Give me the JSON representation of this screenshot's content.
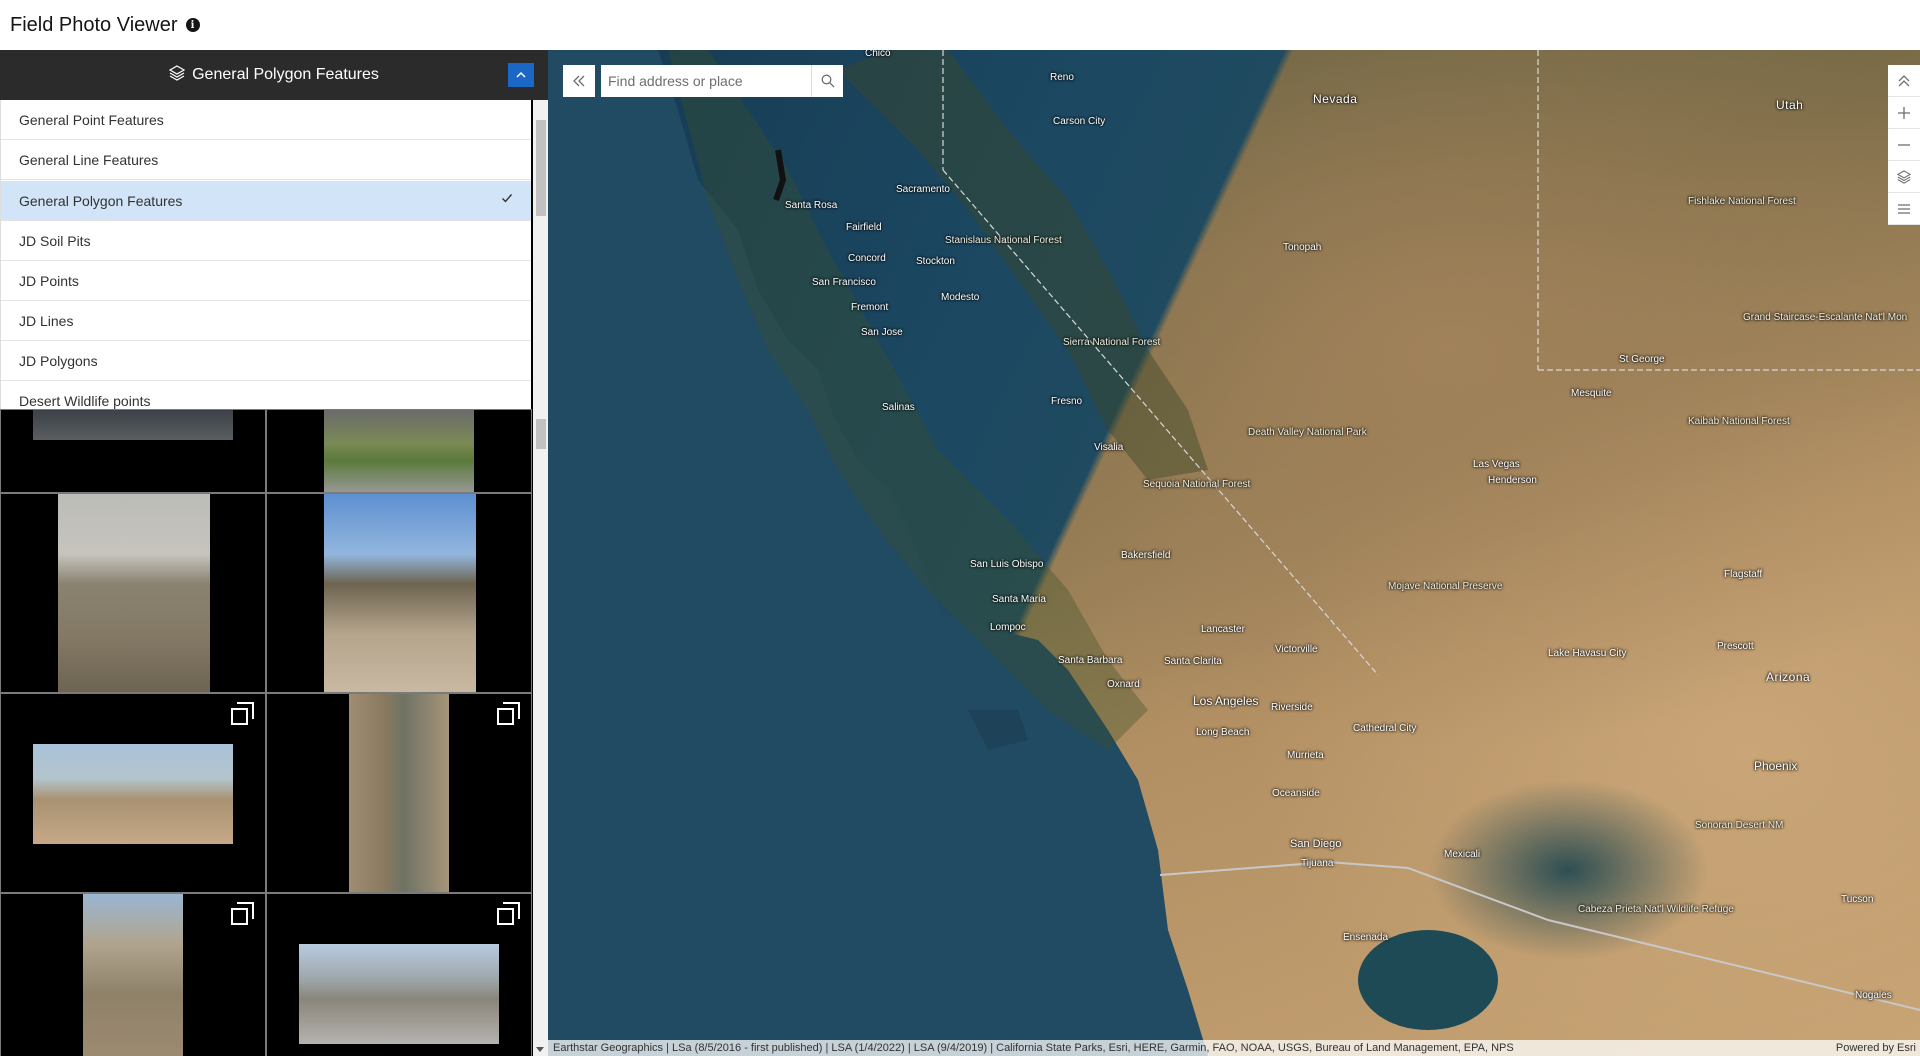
{
  "app": {
    "title": "Field Photo Viewer",
    "info_icon": "info-icon"
  },
  "layer_panel": {
    "selected_layer": "General Polygon Features",
    "items": [
      {
        "label": "General Point Features",
        "selected": false
      },
      {
        "label": "General Line Features",
        "selected": false
      },
      {
        "label": "General Polygon Features",
        "selected": true
      },
      {
        "label": "JD Soil Pits",
        "selected": false
      },
      {
        "label": "JD Points",
        "selected": false
      },
      {
        "label": "JD Lines",
        "selected": false
      },
      {
        "label": "JD Polygons",
        "selected": false
      },
      {
        "label": "Desert Wildlife points",
        "selected": false
      }
    ]
  },
  "photo_grid": {
    "tiles": [
      {
        "name": "photo-tile-1",
        "multi": false
      },
      {
        "name": "photo-tile-2",
        "multi": false
      },
      {
        "name": "photo-tile-3",
        "multi": false
      },
      {
        "name": "photo-tile-4",
        "multi": false
      },
      {
        "name": "photo-tile-5",
        "multi": true
      },
      {
        "name": "photo-tile-6",
        "multi": true
      },
      {
        "name": "photo-tile-7",
        "multi": true
      },
      {
        "name": "photo-tile-8",
        "multi": true
      }
    ]
  },
  "search": {
    "placeholder": "Find address or place"
  },
  "map_labels": {
    "states": [
      "Nevada",
      "Utah",
      "Arizona"
    ],
    "cities": [
      "Chico",
      "Reno",
      "Carson City",
      "Sacramento",
      "Santa Rosa",
      "Fairfield",
      "Concord",
      "Stockton",
      "San Francisco",
      "Fremont",
      "Modesto",
      "San Jose",
      "Salinas",
      "Fresno",
      "Visalia",
      "Bakersfield",
      "San Luis Obispo",
      "Santa Maria",
      "Lompoc",
      "Santa Barbara",
      "Oxnard",
      "Santa Clarita",
      "Los Angeles",
      "Long Beach",
      "Lancaster",
      "Victorville",
      "Riverside",
      "Cathedral City",
      "Murrieta",
      "Oceanside",
      "San Diego",
      "Tijuana",
      "Ensenada",
      "Mexicali",
      "Las Vegas",
      "Henderson",
      "Tonopah",
      "Mesquite",
      "St George",
      "Lake Havasu City",
      "Flagstaff",
      "Prescott",
      "Phoenix",
      "Tucson",
      "Nogales"
    ],
    "areas": [
      "Stanislaus National Forest",
      "Sierra National Forest",
      "Sequoia National Forest",
      "Death Valley National Park",
      "Mojave National Preserve",
      "Fishlake National Forest",
      "Grand Staircase-Escalante Nat'l Mon",
      "Kaibab National Forest",
      "Sonoran Desert NM",
      "Cabeza Prieta Nat'l Wildlife Refuge"
    ]
  },
  "attribution": {
    "text": "Earthstar Geographics | LSa (8/5/2016 - first published) | LSA (1/4/2022) | LSA (9/4/2019) | California State Parks, Esri, HERE, Garmin, FAO, NOAA, USGS, Bureau of Land Management, EPA, NPS",
    "powered_by": "Powered by Esri"
  }
}
